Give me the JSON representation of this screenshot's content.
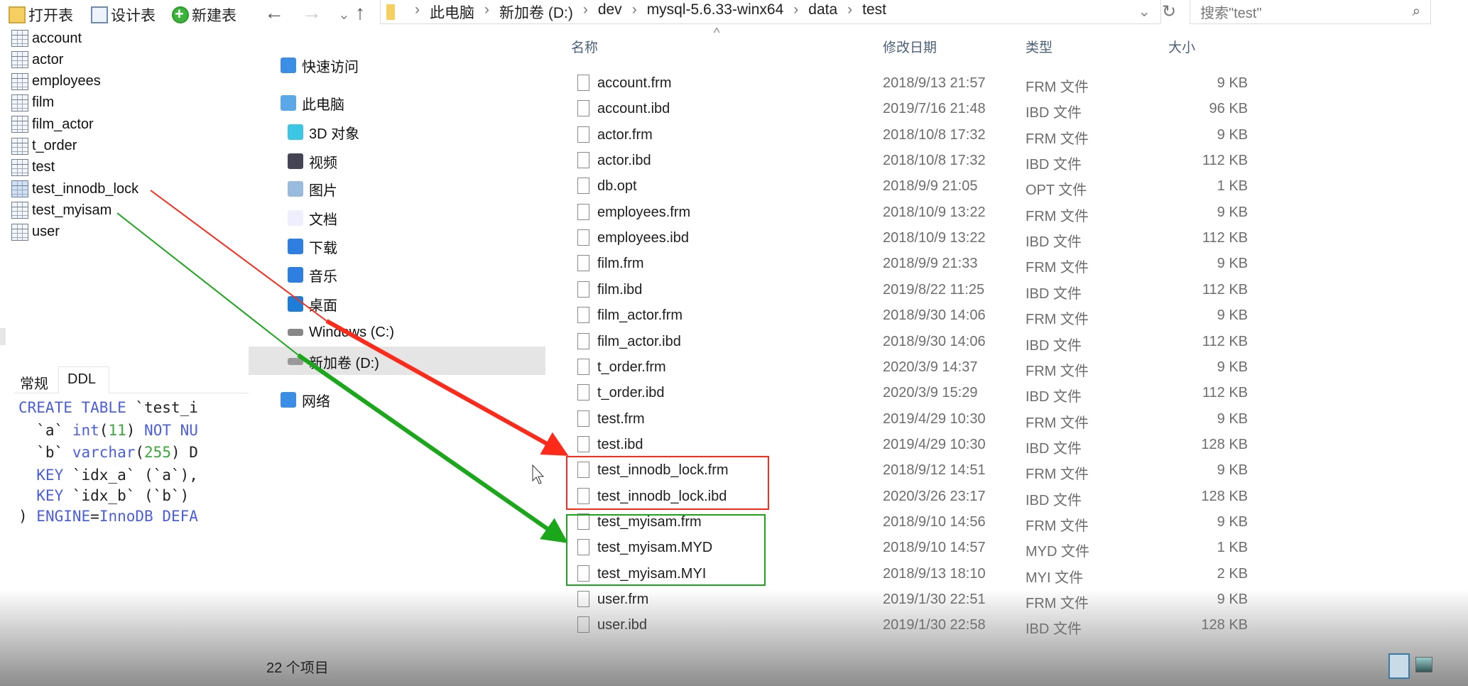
{
  "navicat": {
    "toolbar": {
      "open": "打开表",
      "design": "设计表",
      "new": "新建表"
    },
    "tables": [
      "account",
      "actor",
      "employees",
      "film",
      "film_actor",
      "t_order",
      "test",
      "test_innodb_lock",
      "test_myisam",
      "user"
    ],
    "tabs": {
      "general": "常规",
      "ddl": "DDL"
    },
    "ddl_lines": [
      [
        {
          "t": "CREATE TABLE ",
          "c": "kw"
        },
        {
          "t": "`test_i",
          "c": ""
        }
      ],
      [
        {
          "t": "  `a` ",
          "c": ""
        },
        {
          "t": "int",
          "c": "kw"
        },
        {
          "t": "(",
          "c": ""
        },
        {
          "t": "11",
          "c": "num"
        },
        {
          "t": ") ",
          "c": ""
        },
        {
          "t": "NOT NU",
          "c": "kw"
        }
      ],
      [
        {
          "t": "  `b` ",
          "c": ""
        },
        {
          "t": "varchar",
          "c": "kw"
        },
        {
          "t": "(",
          "c": ""
        },
        {
          "t": "255",
          "c": "num"
        },
        {
          "t": ") D",
          "c": ""
        }
      ],
      [
        {
          "t": "  KEY ",
          "c": "kw"
        },
        {
          "t": "`idx_a` (`a`),",
          "c": ""
        }
      ],
      [
        {
          "t": "  KEY ",
          "c": "kw"
        },
        {
          "t": "`idx_b` (`b`)",
          "c": ""
        }
      ],
      [
        {
          "t": ") ",
          "c": ""
        },
        {
          "t": "ENGINE",
          "c": "kw"
        },
        {
          "t": "=",
          "c": ""
        },
        {
          "t": "InnoDB DEFA",
          "c": "kw"
        }
      ]
    ]
  },
  "explorer": {
    "breadcrumb": [
      "此电脑",
      "新加卷 (D:)",
      "dev",
      "mysql-5.6.33-winx64",
      "data",
      "test"
    ],
    "search_placeholder": "搜索\"test\"",
    "nav": {
      "quick": "快速访问",
      "pc": "此电脑",
      "3d": "3D 对象",
      "video": "视频",
      "pictures": "图片",
      "docs": "文档",
      "downloads": "下载",
      "music": "音乐",
      "desktop": "桌面",
      "c_drive": "Windows (C:)",
      "d_drive": "新加卷 (D:)",
      "network": "网络"
    },
    "columns": {
      "name": "名称",
      "date": "修改日期",
      "type": "类型",
      "size": "大小"
    },
    "files": [
      [
        "account.frm",
        "2018/9/13 21:57",
        "FRM 文件",
        "9 KB"
      ],
      [
        "account.ibd",
        "2019/7/16 21:48",
        "IBD 文件",
        "96 KB"
      ],
      [
        "actor.frm",
        "2018/10/8 17:32",
        "FRM 文件",
        "9 KB"
      ],
      [
        "actor.ibd",
        "2018/10/8 17:32",
        "IBD 文件",
        "112 KB"
      ],
      [
        "db.opt",
        "2018/9/9 21:05",
        "OPT 文件",
        "1 KB"
      ],
      [
        "employees.frm",
        "2018/10/9 13:22",
        "FRM 文件",
        "9 KB"
      ],
      [
        "employees.ibd",
        "2018/10/9 13:22",
        "IBD 文件",
        "112 KB"
      ],
      [
        "film.frm",
        "2018/9/9 21:33",
        "FRM 文件",
        "9 KB"
      ],
      [
        "film.ibd",
        "2019/8/22 11:25",
        "IBD 文件",
        "112 KB"
      ],
      [
        "film_actor.frm",
        "2018/9/30 14:06",
        "FRM 文件",
        "9 KB"
      ],
      [
        "film_actor.ibd",
        "2018/9/30 14:06",
        "IBD 文件",
        "112 KB"
      ],
      [
        "t_order.frm",
        "2020/3/9 14:37",
        "FRM 文件",
        "9 KB"
      ],
      [
        "t_order.ibd",
        "2020/3/9 15:29",
        "IBD 文件",
        "112 KB"
      ],
      [
        "test.frm",
        "2019/4/29 10:30",
        "FRM 文件",
        "9 KB"
      ],
      [
        "test.ibd",
        "2019/4/29 10:30",
        "IBD 文件",
        "128 KB"
      ],
      [
        "test_innodb_lock.frm",
        "2018/9/12 14:51",
        "FRM 文件",
        "9 KB"
      ],
      [
        "test_innodb_lock.ibd",
        "2020/3/26 23:17",
        "IBD 文件",
        "128 KB"
      ],
      [
        "test_myisam.frm",
        "2018/9/10 14:56",
        "FRM 文件",
        "9 KB"
      ],
      [
        "test_myisam.MYD",
        "2018/9/10 14:57",
        "MYD 文件",
        "1 KB"
      ],
      [
        "test_myisam.MYI",
        "2018/9/13 18:10",
        "MYI 文件",
        "2 KB"
      ],
      [
        "user.frm",
        "2019/1/30 22:51",
        "FRM 文件",
        "9 KB"
      ],
      [
        "user.ibd",
        "2019/1/30 22:58",
        "IBD 文件",
        "128 KB"
      ]
    ],
    "status": "22 个项目"
  },
  "annotations": {
    "innodb_color": "#ff2a1a",
    "myisam_color": "#1aa81a"
  }
}
